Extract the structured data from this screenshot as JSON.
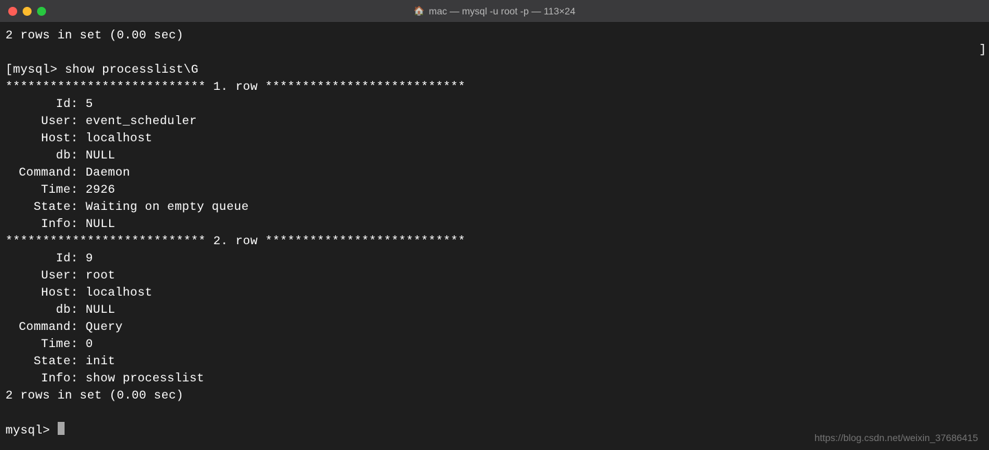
{
  "titlebar": {
    "home_icon": "🏠",
    "title": "mac — mysql -u root -p — 113×24"
  },
  "prev_summary": "2 rows in set (0.00 sec)",
  "prompt_prefix_left": "[",
  "prompt": "mysql> ",
  "command": "show processlist\\G",
  "bracket_right": "]",
  "row_header_prefix": "*************************** ",
  "row_header_suffix": " ***************************",
  "row1_label": "1. row",
  "row2_label": "2. row",
  "fields": {
    "id": "Id",
    "user": "User",
    "host": "Host",
    "db": "db",
    "command": "Command",
    "time": "Time",
    "state": "State",
    "info": "Info"
  },
  "row1": {
    "id": "5",
    "user": "event_scheduler",
    "host": "localhost",
    "db": "NULL",
    "command": "Daemon",
    "time": "2926",
    "state": "Waiting on empty queue",
    "info": "NULL"
  },
  "row2": {
    "id": "9",
    "user": "root",
    "host": "localhost",
    "db": "NULL",
    "command": "Query",
    "time": "0",
    "state": "init",
    "info": "show processlist"
  },
  "summary": "2 rows in set (0.00 sec)",
  "final_prompt": "mysql> ",
  "watermark": "https://blog.csdn.net/weixin_37686415"
}
